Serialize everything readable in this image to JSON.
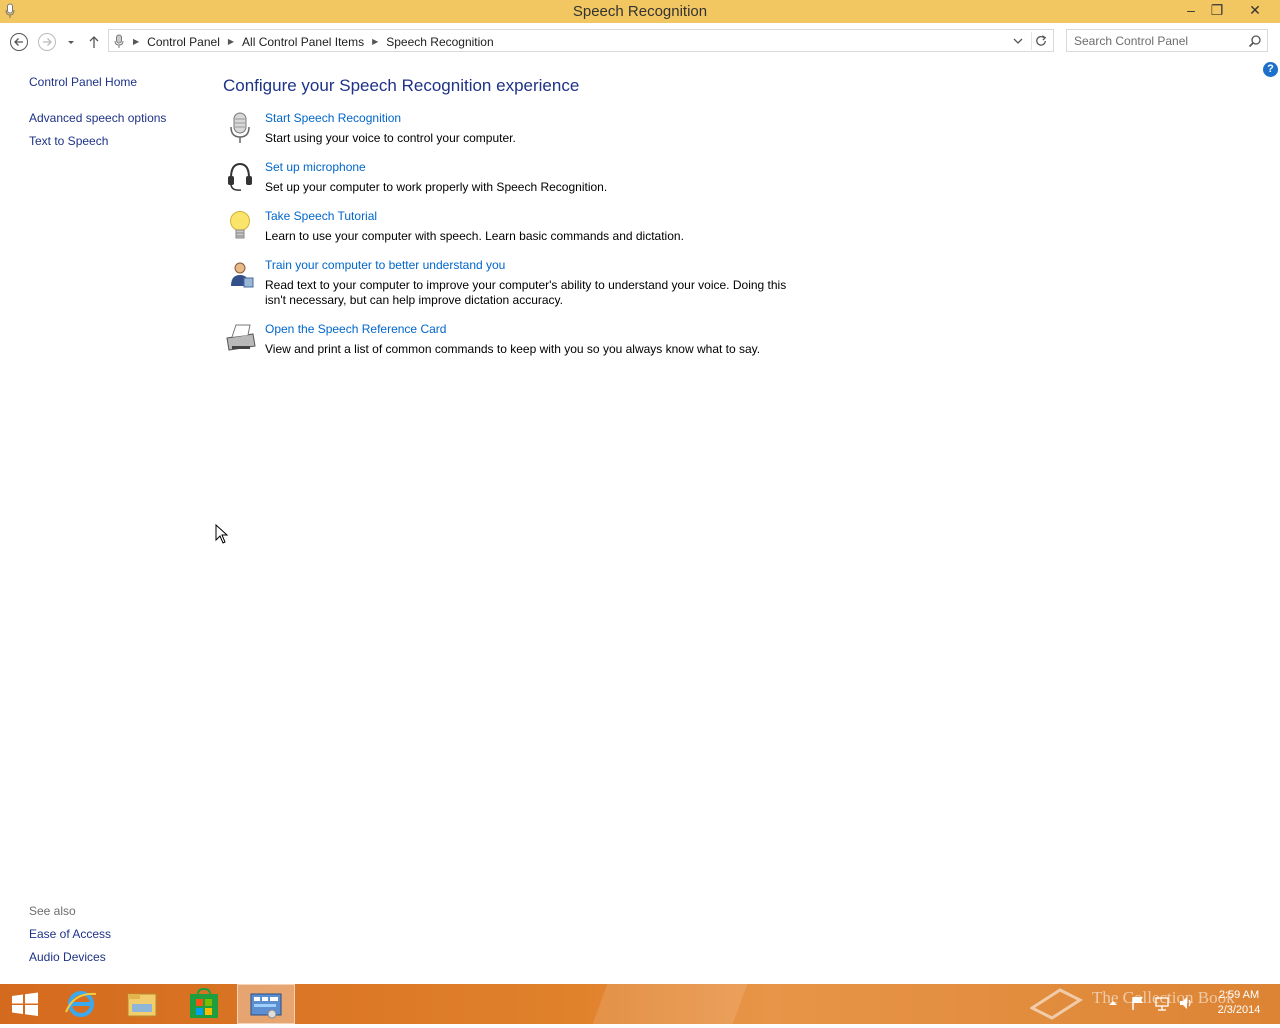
{
  "window": {
    "title": "Speech Recognition",
    "controls": {
      "minimize": "–",
      "restore": "❐",
      "close": "✕"
    }
  },
  "address_bar": {
    "crumbs": [
      "Control Panel",
      "All Control Panel Items",
      "Speech Recognition"
    ],
    "search_placeholder": "Search Control Panel"
  },
  "left_pane": {
    "home": "Control Panel Home",
    "links": [
      "Advanced speech options",
      "Text to Speech"
    ],
    "see_also_header": "See also",
    "see_also": [
      "Ease of Access",
      "Audio Devices"
    ]
  },
  "main": {
    "heading": "Configure your Speech Recognition experience",
    "tasks": [
      {
        "icon": "microphone-icon",
        "link": "Start Speech Recognition",
        "desc": "Start using your voice to control your computer."
      },
      {
        "icon": "headset-icon",
        "link": "Set up microphone",
        "desc": "Set up your computer to work properly with Speech Recognition."
      },
      {
        "icon": "lightbulb-icon",
        "link": "Take Speech Tutorial",
        "desc": "Learn to use your computer with speech.  Learn basic commands and dictation."
      },
      {
        "icon": "user-icon",
        "link": "Train your computer to better understand you",
        "desc": "Read text to your computer to improve your computer's ability to understand your voice.  Doing this isn't necessary, but can help improve dictation accuracy."
      },
      {
        "icon": "printer-icon",
        "link": "Open the Speech Reference Card",
        "desc": "View and print a list of common commands to keep with you so you always know what to say."
      }
    ],
    "help": "?"
  },
  "taskbar": {
    "clock_time": "2:59 AM",
    "clock_date": "2/3/2014",
    "watermark": "The Collection Book",
    "colors": {
      "taskbar": "#e0812c",
      "titlebar": "#f2c761",
      "link": "#0066cc"
    }
  }
}
